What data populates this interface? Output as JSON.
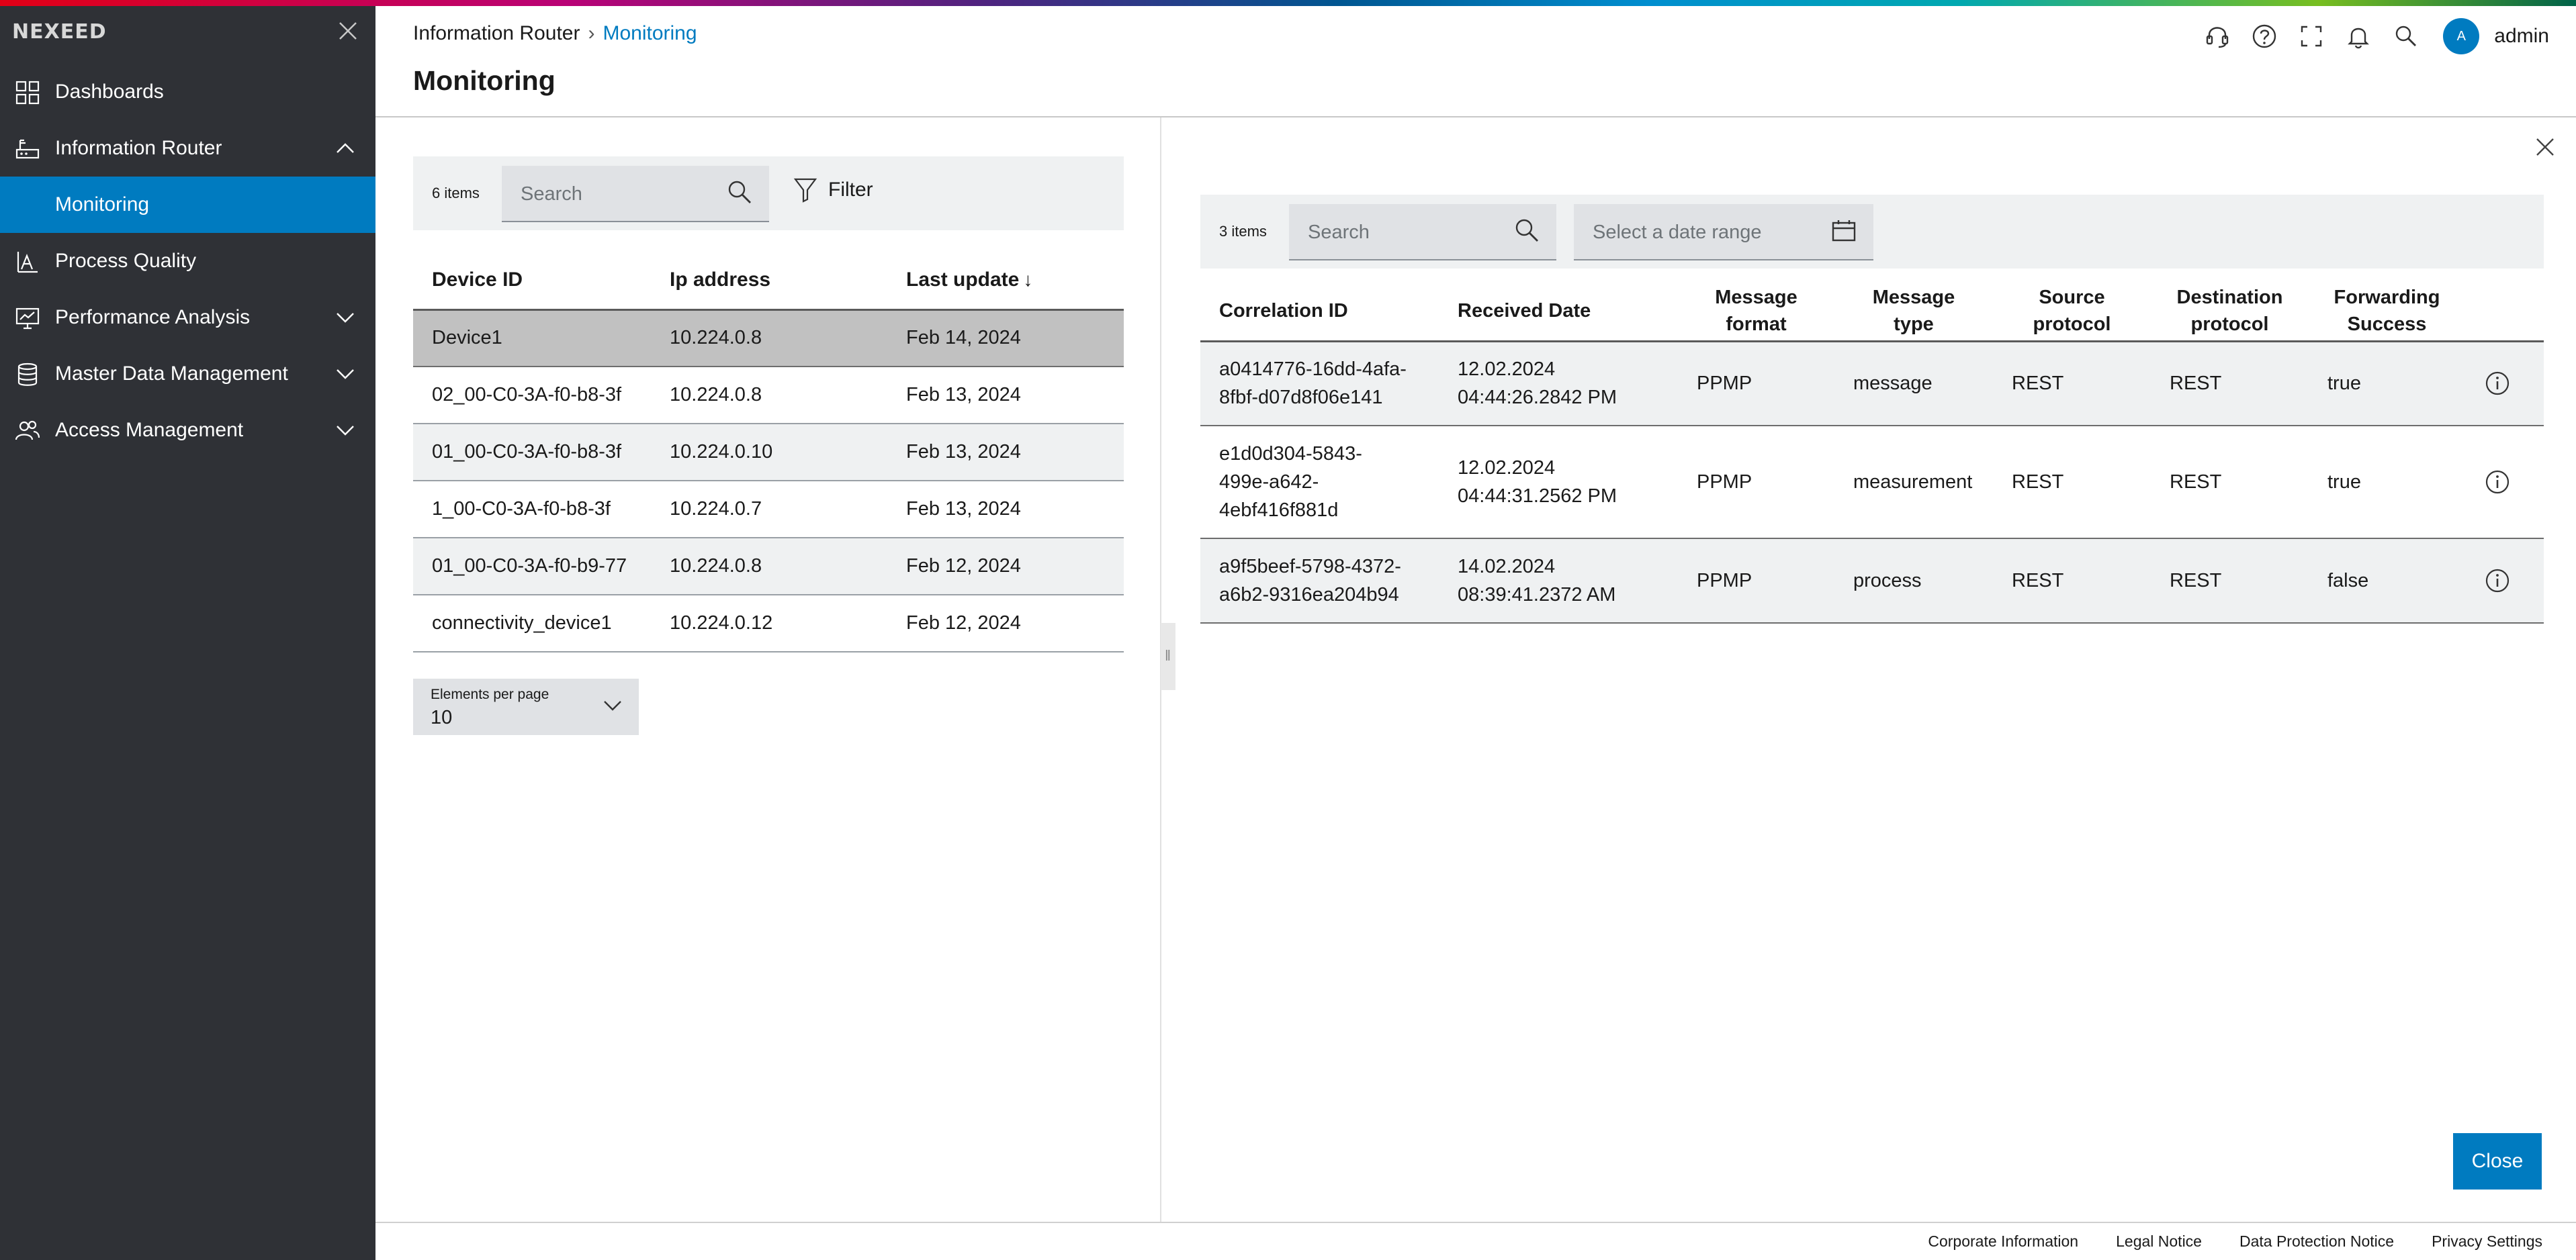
{
  "app": {
    "brand": "NEXEED",
    "user": "admin",
    "avatar_initial": "A",
    "accent_color": "#007bc0"
  },
  "sidebar": {
    "items": [
      {
        "label": "Dashboards",
        "icon": "dashboard-grid-icon"
      },
      {
        "label": "Information Router",
        "icon": "router-icon",
        "expanded": true
      },
      {
        "label": "Monitoring",
        "active": true
      },
      {
        "label": "Process Quality",
        "icon": "quality-icon"
      },
      {
        "label": "Performance Analysis",
        "icon": "monitor-chart-icon"
      },
      {
        "label": "Master Data Management",
        "icon": "database-icon"
      },
      {
        "label": "Access Management",
        "icon": "users-icon"
      }
    ]
  },
  "header": {
    "breadcrumb": [
      "Information Router",
      "Monitoring"
    ],
    "title": "Monitoring"
  },
  "devices": {
    "count_label": "6 items",
    "search_placeholder": "Search",
    "filter_label": "Filter",
    "columns": [
      "Device ID",
      "Ip address",
      "Last update"
    ],
    "sort_indicator": "↓",
    "rows": [
      [
        "Device1",
        "10.224.0.8",
        "Feb 14, 2024"
      ],
      [
        "02_00-C0-3A-f0-b8-3f",
        "10.224.0.8",
        "Feb 13, 2024"
      ],
      [
        "01_00-C0-3A-f0-b8-3f",
        "10.224.0.10",
        "Feb 13, 2024"
      ],
      [
        "1_00-C0-3A-f0-b8-3f",
        "10.224.0.7",
        "Feb 13, 2024"
      ],
      [
        "01_00-C0-3A-f0-b9-77",
        "10.224.0.8",
        "Feb 12, 2024"
      ],
      [
        "connectivity_device1",
        "10.224.0.12",
        "Feb 12, 2024"
      ]
    ],
    "per_page_label": "Elements per page",
    "per_page_value": "10"
  },
  "messages": {
    "count_label": "3 items",
    "search_placeholder": "Search",
    "date_placeholder": "Select a date range",
    "columns": {
      "correlation": "Correlation ID",
      "received": "Received Date",
      "format": [
        "Message",
        "format"
      ],
      "type": [
        "Message",
        "type"
      ],
      "source": [
        "Source",
        "protocol"
      ],
      "destination": [
        "Destination",
        "protocol"
      ],
      "forwarding": [
        "Forwarding",
        "Success"
      ]
    },
    "rows": [
      {
        "id": [
          "a0414776-16dd-4afa-",
          "8fbf-d07d8f06e141"
        ],
        "date": [
          "12.02.2024",
          "04:44:26.2842 PM"
        ],
        "format": "PPMP",
        "type": "message",
        "source": "REST",
        "destination": "REST",
        "success": "true"
      },
      {
        "id": [
          "e1d0d304-5843-",
          "499e-a642-",
          "4ebf416f881d"
        ],
        "date": [
          "12.02.2024",
          "04:44:31.2562 PM"
        ],
        "format": "PPMP",
        "type": "measurement",
        "source": "REST",
        "destination": "REST",
        "success": "true"
      },
      {
        "id": [
          "a9f5beef-5798-4372-",
          "a6b2-9316ea204b94"
        ],
        "date": [
          "14.02.2024",
          "08:39:41.2372 AM"
        ],
        "format": "PPMP",
        "type": "process",
        "source": "REST",
        "destination": "REST",
        "success": "false"
      }
    ],
    "close_label": "Close"
  },
  "footer": {
    "links": [
      "Corporate Information",
      "Legal Notice",
      "Data Protection Notice",
      "Privacy Settings"
    ]
  }
}
